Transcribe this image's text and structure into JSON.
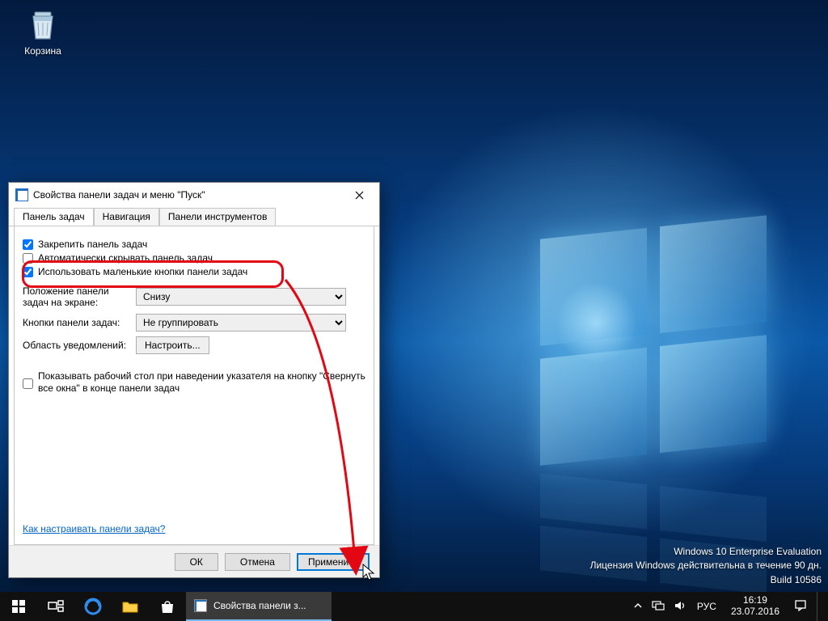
{
  "desktop": {
    "recycle_label": "Корзина"
  },
  "watermark": {
    "line1": "Windows 10 Enterprise Evaluation",
    "line2": "Лицензия Windows действительна в течение 90 дн.",
    "line3": "Build 10586"
  },
  "dialog": {
    "title": "Свойства панели задач и меню \"Пуск\"",
    "tabs": {
      "taskbar": "Панель задач",
      "navigation": "Навигация",
      "toolbars": "Панели инструментов"
    },
    "taskbar_tab": {
      "lock_taskbar": {
        "label": "Закрепить панель задач",
        "checked": true
      },
      "autohide": {
        "label": "Автоматически скрывать панель задач",
        "checked": false
      },
      "small_buttons": {
        "label": "Использовать маленькие кнопки панели задач",
        "checked": true
      },
      "position_label": "Положение панели задач на экране:",
      "position_value": "Снизу",
      "buttons_label": "Кнопки панели задач:",
      "buttons_value": "Не группировать",
      "notify_label": "Область уведомлений:",
      "notify_button": "Настроить...",
      "peek_label": "Показывать рабочий стол при наведении указателя на кнопку \"Свернуть все окна\" в конце панели задач",
      "peek_checked": false,
      "help_link": "Как настраивать панели задач?"
    },
    "buttons": {
      "ok": "ОК",
      "cancel": "Отмена",
      "apply": "Применить"
    }
  },
  "taskbar": {
    "running_title": "Свойства панели з...",
    "lang": "РУС",
    "time": "16:19",
    "date": "23.07.2016"
  }
}
